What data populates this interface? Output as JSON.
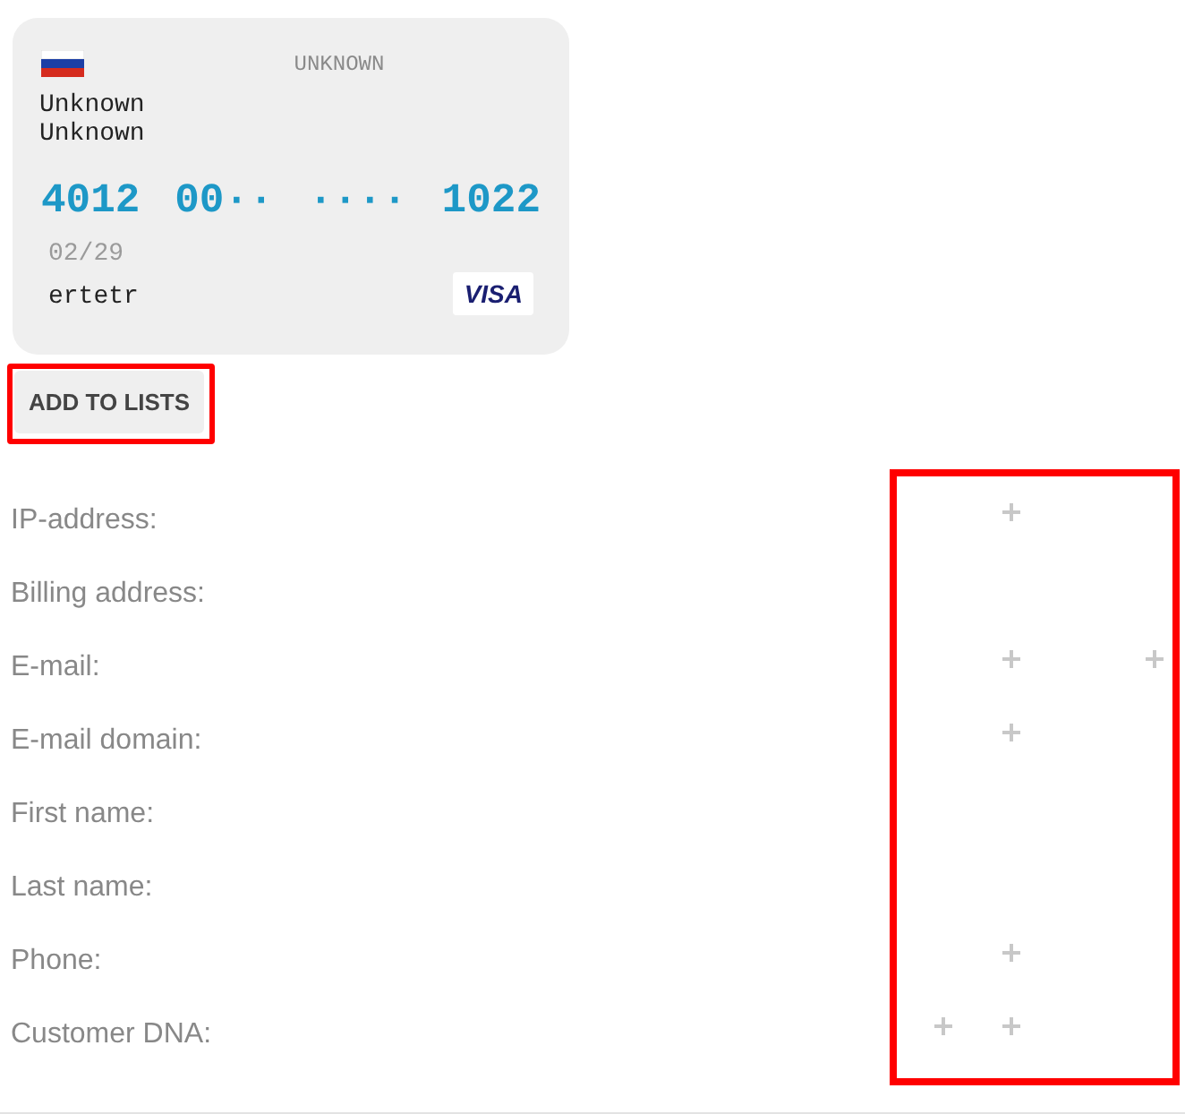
{
  "card": {
    "brand_label": "UNKNOWN",
    "bank_lines": [
      "Unknown",
      "Unknown"
    ],
    "number_groups": [
      "4012",
      "00··",
      "····",
      "1022"
    ],
    "expiry": "02/29",
    "holder": "ertetr",
    "network": "VISA"
  },
  "add_button": {
    "label": "ADD TO LISTS",
    "highlighted": true
  },
  "actions_highlighted": true,
  "rows": [
    {
      "label": "IP-address:",
      "left_plus": false,
      "mid_plus": true,
      "right_plus": false
    },
    {
      "label": "Billing address:",
      "left_plus": false,
      "mid_plus": false,
      "right_plus": false
    },
    {
      "label": "E-mail:",
      "left_plus": false,
      "mid_plus": true,
      "right_plus": true
    },
    {
      "label": "E-mail domain:",
      "left_plus": false,
      "mid_plus": true,
      "right_plus": false
    },
    {
      "label": "First name:",
      "left_plus": false,
      "mid_plus": false,
      "right_plus": false
    },
    {
      "label": "Last name:",
      "left_plus": false,
      "mid_plus": false,
      "right_plus": false
    },
    {
      "label": "Phone:",
      "left_plus": false,
      "mid_plus": true,
      "right_plus": false
    },
    {
      "label": "Customer DNA:",
      "left_plus": true,
      "mid_plus": true,
      "right_plus": false
    }
  ]
}
